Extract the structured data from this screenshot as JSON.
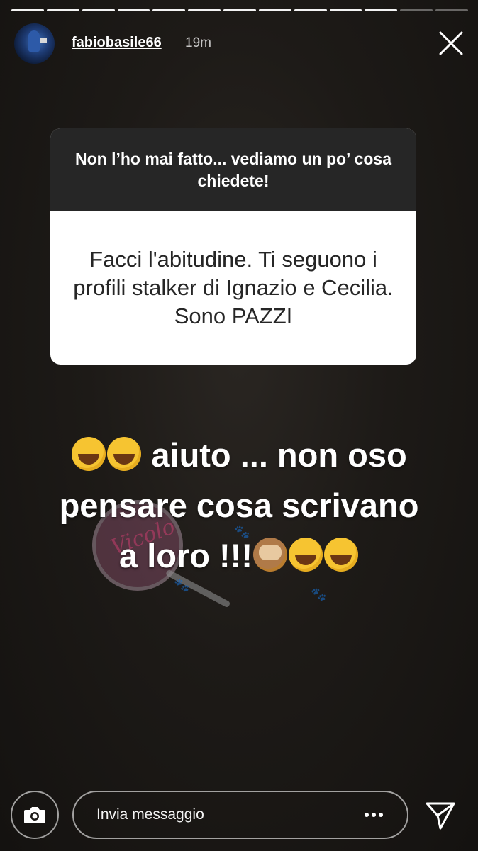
{
  "story": {
    "segments_total": 13,
    "segments_viewed": 11
  },
  "header": {
    "username": "fabiobasile66",
    "time": "19m",
    "avatar_icon": "profile-avatar",
    "close_icon": "close-icon"
  },
  "question_card": {
    "prompt": "Non l’ho mai fatto... vediamo un po’ cosa chiedete!",
    "answer": "Facci l'abitudine. Ti seguono i profili stalker di Ignazio e Cecilia. Sono PAZZI"
  },
  "caption": {
    "line1_text": "aiuto ... non oso",
    "line2_text": "pensare cosa scrivano",
    "line3_text": "a loro !!!",
    "emojis": [
      "face-with-tears-of-joy",
      "face-with-tears-of-joy",
      "see-no-evil-monkey",
      "rolling-on-floor-laughing",
      "rolling-on-floor-laughing"
    ]
  },
  "footer": {
    "message_placeholder": "Invia messaggio",
    "camera_icon": "camera-icon",
    "more_icon": "more-options-icon",
    "send_icon": "send-icon"
  },
  "colors": {
    "background": "#1b1815",
    "card_header": "#262626",
    "card_body": "#ffffff",
    "text": "#ffffff"
  }
}
